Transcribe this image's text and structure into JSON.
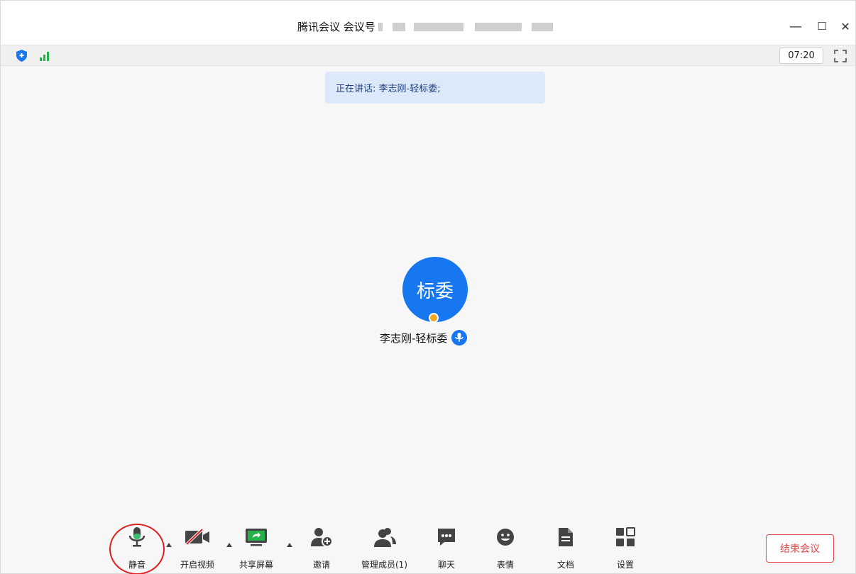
{
  "window": {
    "title": "腾讯会议 会议号",
    "controls": {
      "minimize": "—",
      "maximize": "☐",
      "close": "✕"
    }
  },
  "statusbar": {
    "timer": "07:20",
    "icons": [
      "shield-icon",
      "signal-icon",
      "fullscreen-icon"
    ]
  },
  "banner": {
    "speaking": "正在讲话: 李志刚-轻标委;"
  },
  "participant": {
    "avatar_text": "标委",
    "name": "李志刚-轻标委"
  },
  "toolbar": {
    "mute": "静音",
    "video": "开启视频",
    "share": "共享屏幕",
    "invite": "邀请",
    "members": "管理成员(1)",
    "chat": "聊天",
    "reactions": "表情",
    "docs": "文档",
    "settings": "设置",
    "end_meeting": "结束会议"
  },
  "colors": {
    "accent": "#1677f0",
    "end_button": "#e24b4b",
    "mic_active": "#3cc06b",
    "share_green": "#27b14a",
    "banner_bg": "#dce9fb"
  }
}
